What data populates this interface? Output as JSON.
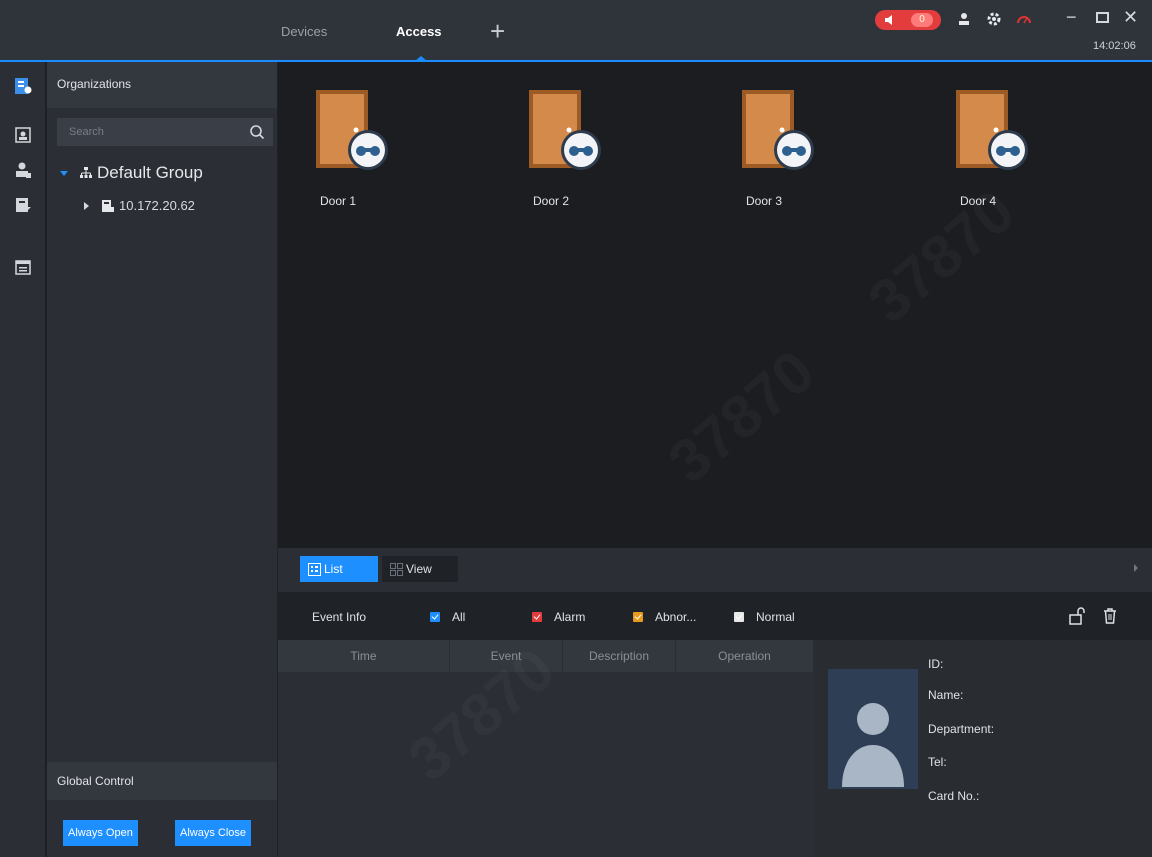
{
  "header": {
    "tabs": [
      {
        "label": "Devices",
        "active": false
      },
      {
        "label": "Access",
        "active": true
      }
    ],
    "alarm_count": "0",
    "time": "14:02:06"
  },
  "sidebar": {
    "organizations_title": "Organizations",
    "search_placeholder": "Search",
    "tree": {
      "group_label": "Default Group",
      "device_label": "10.172.20.62"
    },
    "global_control_title": "Global Control",
    "always_open_label": "Always Open",
    "always_close_label": "Always Close"
  },
  "doors": [
    {
      "name": "Door 1"
    },
    {
      "name": "Door 2"
    },
    {
      "name": "Door 3"
    },
    {
      "name": "Door 4"
    }
  ],
  "toolbar": {
    "list_label": "List",
    "view_label": "View"
  },
  "events": {
    "title": "Event Info",
    "filters": [
      {
        "label": "All",
        "color": "#1e8fff"
      },
      {
        "label": "Alarm",
        "color": "#e23c3c"
      },
      {
        "label": "Abnor...",
        "color": "#e89a1c"
      },
      {
        "label": "Normal",
        "color": "#e8e8e8"
      }
    ],
    "columns": [
      "Time",
      "Event",
      "Description",
      "Operation"
    ]
  },
  "person": {
    "id_label": "ID:",
    "name_label": "Name:",
    "department_label": "Department:",
    "tel_label": "Tel:",
    "card_label": "Card No.:"
  },
  "colors": {
    "accent": "#1e8fff",
    "alarm": "#e23c3c",
    "door": "#c8773a"
  }
}
